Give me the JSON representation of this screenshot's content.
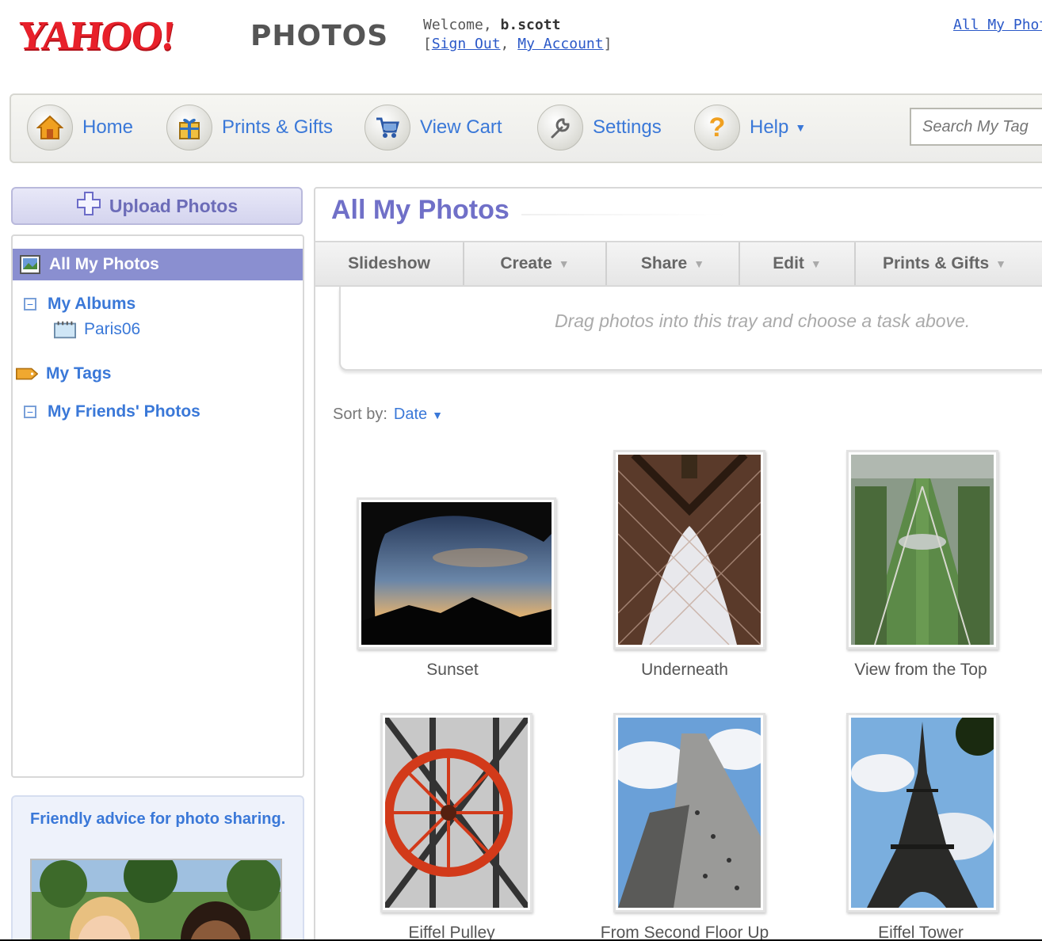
{
  "header": {
    "logo_yahoo": "YAHOO!",
    "logo_photos": "PHOTOS",
    "welcome_prefix": "Welcome,",
    "username": "b.scott",
    "sign_out": "Sign Out",
    "my_account": "My Account",
    "top_link": "All My Phot"
  },
  "nav": {
    "items": [
      {
        "label": "Home",
        "icon": "home-icon"
      },
      {
        "label": "Prints & Gifts",
        "icon": "gift-icon"
      },
      {
        "label": "View Cart",
        "icon": "cart-icon"
      },
      {
        "label": "Settings",
        "icon": "wrench-icon"
      },
      {
        "label": "Help",
        "icon": "help-icon"
      }
    ],
    "search_placeholder": "Search My Tag"
  },
  "sidebar": {
    "upload_label": "Upload Photos",
    "all_my_photos": "All My Photos",
    "my_albums": "My Albums",
    "album_paris": "Paris06",
    "my_tags": "My Tags",
    "my_friends_photos": "My Friends' Photos",
    "advice_title": "Friendly advice for photo sharing."
  },
  "main": {
    "title": "All My Photos",
    "toolbar": [
      {
        "label": "Slideshow",
        "dropdown": false
      },
      {
        "label": "Create",
        "dropdown": true
      },
      {
        "label": "Share",
        "dropdown": true
      },
      {
        "label": "Edit",
        "dropdown": true
      },
      {
        "label": "Prints & Gifts",
        "dropdown": true
      }
    ],
    "tray_text": "Drag photos into this tray and choose a task above.",
    "sort_label": "Sort by:",
    "sort_value": "Date",
    "photos": [
      {
        "caption": "Sunset"
      },
      {
        "caption": "Underneath"
      },
      {
        "caption": "View from the Top"
      },
      {
        "caption": "Eiffel Pulley"
      },
      {
        "caption": "From Second Floor Up"
      },
      {
        "caption": "Eiffel Tower"
      }
    ]
  },
  "colors": {
    "accent": "#3a78d8",
    "active_nav": "#8a8fd0",
    "title": "#7070c8",
    "logo_red": "#e8202a"
  }
}
